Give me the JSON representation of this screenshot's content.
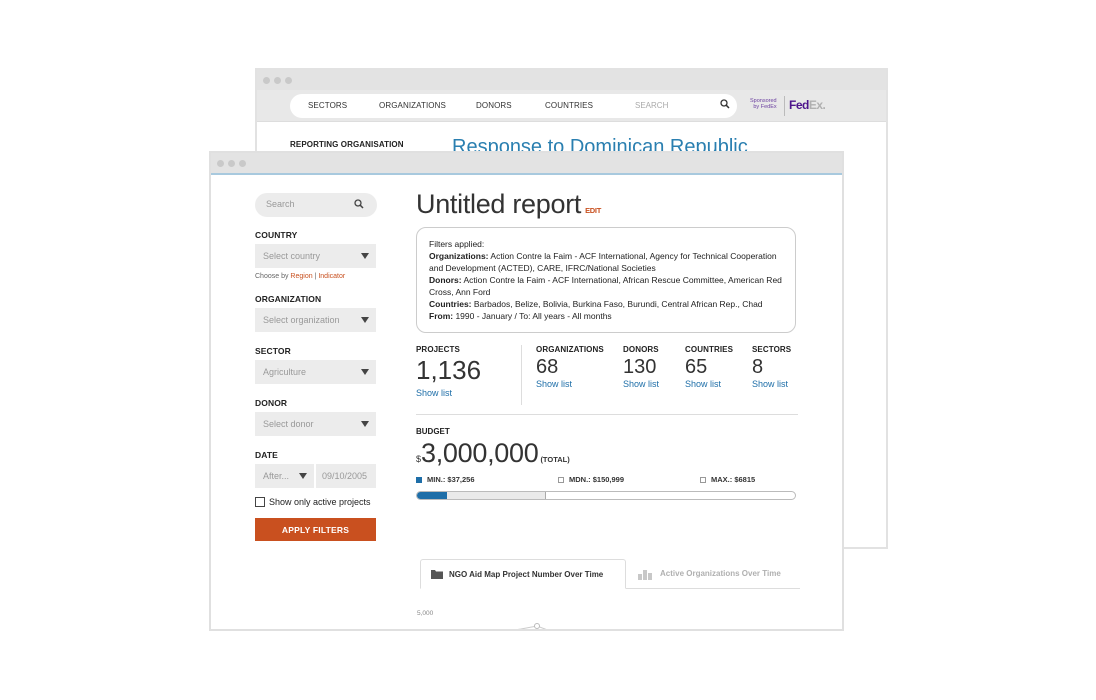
{
  "back_window": {
    "nav": [
      "SECTORS",
      "ORGANIZATIONS",
      "DONORS",
      "COUNTRIES"
    ],
    "search_placeholder": "SEARCH",
    "sponsor_line1": "Sponsored",
    "sponsor_line2": "by FedEx",
    "fedex_fed": "Fed",
    "fedex_ex": "Ex",
    "fedex_dot": ".",
    "section_label": "REPORTING ORGANISATION",
    "title": "Response to Dominican Republic"
  },
  "sidebar": {
    "search_placeholder": "Search",
    "country_label": "COUNTRY",
    "country_select": "Select country",
    "choose_by": "Choose by",
    "choose_region": "Region",
    "choose_sep": "|",
    "choose_indicator": "Indicator",
    "organization_label": "ORGANIZATION",
    "organization_select": "Select organization",
    "sector_label": "SECTOR",
    "sector_select": "Agriculture",
    "donor_label": "DONOR",
    "donor_select": "Select donor",
    "date_label": "DATE",
    "date_mode": "After...",
    "date_value": "09/10/2005",
    "active_only": "Show only active projects",
    "apply": "APPLY FILTERS"
  },
  "report": {
    "title": "Untitled report",
    "edit": "EDIT",
    "filters_heading": "Filters applied:",
    "org_key": "Organizations:",
    "org_value": " Action Contre la Faim - ACF International, Agency for Technical Cooperation and Development (ACTED), CARE, IFRC/National Societies",
    "donor_key": "Donors:",
    "donor_value": " Action Contre la Faim - ACF International, African Rescue Committee, American Red Cross, Ann Ford",
    "country_key": "Countries:",
    "country_value": " Barbados, Belize, Bolivia, Burkina Faso, Burundi, Central African Rep., Chad",
    "from_key": "From:",
    "from_value": " 1990 - January / To: All years - All months"
  },
  "stats": {
    "projects": {
      "label": "PROJECTS",
      "value": "1,136",
      "link": "Show list"
    },
    "organizations": {
      "label": "ORGANIZATIONS",
      "value": "68",
      "link": "Show list"
    },
    "donors": {
      "label": "DONORS",
      "value": "130",
      "link": "Show list"
    },
    "countries": {
      "label": "COUNTRIES",
      "value": "65",
      "link": "Show list"
    },
    "sectors": {
      "label": "SECTORS",
      "value": "8",
      "link": "Show list"
    }
  },
  "budget": {
    "label": "BUDGET",
    "currency": "$",
    "amount": "3,000,000",
    "total": "(TOTAL)",
    "min": "MIN.: $37,256",
    "mdn": "MDN.: $150,999",
    "max": "MAX.: $6815",
    "min_fraction": 0.08,
    "mdn_fraction": 0.34
  },
  "tabs": {
    "active": "NGO Aid Map Project Number Over Time",
    "inactive": "Active Organizations Over Time"
  },
  "chart_peek": {
    "y_tick": "5,000"
  },
  "colors": {
    "accent": "#c9501f",
    "link": "#1e6ea8",
    "title_blue": "#2a7fb0"
  }
}
